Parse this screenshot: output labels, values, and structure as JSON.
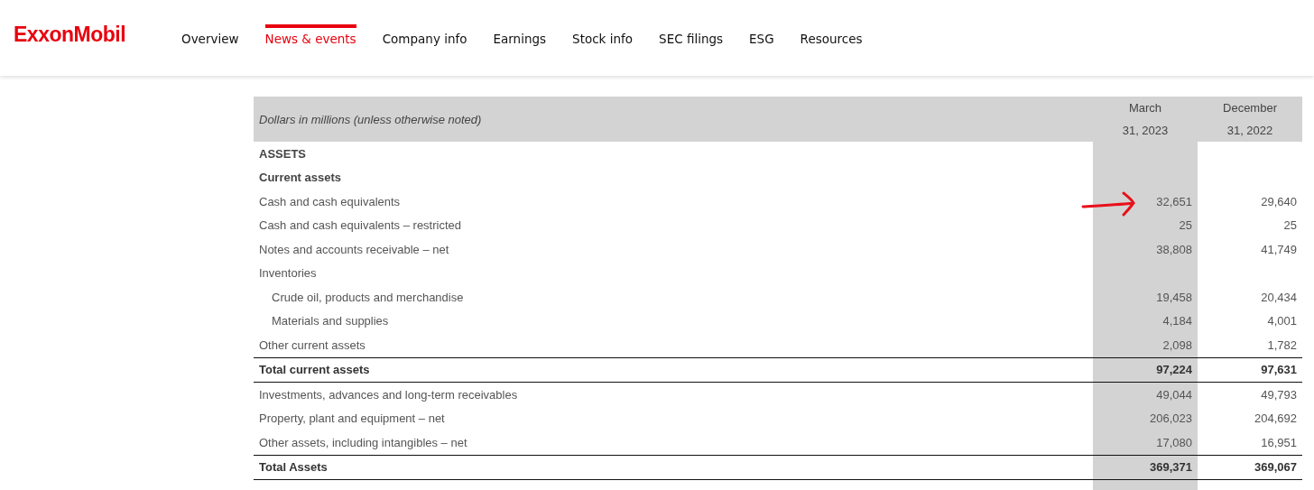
{
  "logo": "ExxonMobil",
  "nav": [
    {
      "label": "Overview",
      "selected": false
    },
    {
      "label": "News & events",
      "selected": true
    },
    {
      "label": "Company info",
      "selected": false
    },
    {
      "label": "Earnings",
      "selected": false
    },
    {
      "label": "Stock info",
      "selected": false
    },
    {
      "label": "SEC filings",
      "selected": false
    },
    {
      "label": "ESG",
      "selected": false
    },
    {
      "label": "Resources",
      "selected": false
    }
  ],
  "table": {
    "caption": "Dollars in millions (unless otherwise noted)",
    "columns": [
      {
        "line1": "March",
        "line2": "31, 2023"
      },
      {
        "line1": "December",
        "line2": "31, 2022"
      }
    ],
    "rows": [
      {
        "kind": "heading",
        "label": "ASSETS",
        "values": []
      },
      {
        "kind": "subheading",
        "label": "Current assets",
        "values": []
      },
      {
        "kind": "line",
        "label": "Cash and cash equivalents",
        "values": [
          "32,651",
          "29,640"
        ],
        "annotated": true
      },
      {
        "kind": "line",
        "label": "Cash and cash equivalents – restricted",
        "values": [
          "25",
          "25"
        ]
      },
      {
        "kind": "line",
        "label": "Notes and accounts receivable – net",
        "values": [
          "38,808",
          "41,749"
        ]
      },
      {
        "kind": "line",
        "label": "Inventories",
        "values": []
      },
      {
        "kind": "indented",
        "label": "Crude oil, products and merchandise",
        "values": [
          "19,458",
          "20,434"
        ]
      },
      {
        "kind": "indented",
        "label": "Materials and supplies",
        "values": [
          "4,184",
          "4,001"
        ]
      },
      {
        "kind": "line",
        "label": "Other current assets",
        "values": [
          "2,098",
          "1,782"
        ]
      },
      {
        "kind": "total",
        "label": "Total current assets",
        "values": [
          "97,224",
          "97,631"
        ]
      },
      {
        "kind": "line",
        "label": "Investments, advances and long-term receivables",
        "values": [
          "49,044",
          "49,793"
        ]
      },
      {
        "kind": "line",
        "label": "Property, plant and equipment – net",
        "values": [
          "206,023",
          "204,692"
        ]
      },
      {
        "kind": "line",
        "label": "Other assets, including intangibles – net",
        "values": [
          "17,080",
          "16,951"
        ]
      },
      {
        "kind": "total",
        "label": "Total Assets",
        "values": [
          "369,371",
          "369,067"
        ]
      }
    ]
  }
}
